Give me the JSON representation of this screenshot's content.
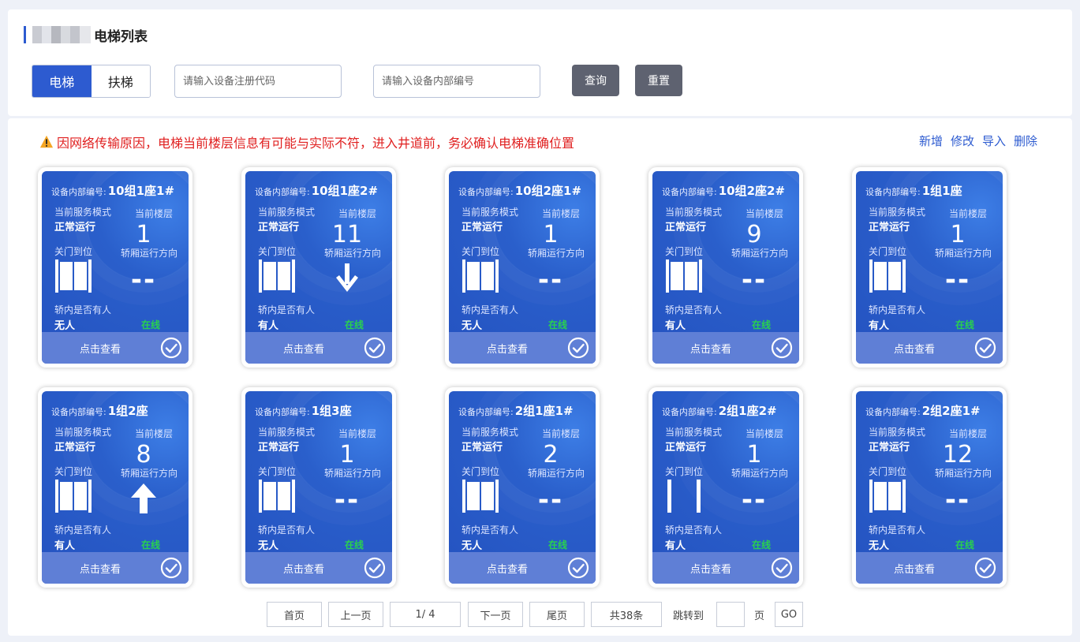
{
  "header": {
    "title": "电梯列表",
    "tabs": [
      {
        "label": "电梯",
        "active": true
      },
      {
        "label": "扶梯",
        "active": false
      }
    ],
    "reg_code_placeholder": "请输入设备注册代码",
    "internal_no_placeholder": "请输入设备内部编号",
    "query_label": "查询",
    "reset_label": "重置"
  },
  "notice": {
    "warning": "因网络传输原因，电梯当前楼层信息有可能与实际不符，进入井道前，务必确认电梯准确位置"
  },
  "actions": {
    "add": "新增",
    "edit": "修改",
    "import": "导入",
    "delete": "删除"
  },
  "labels": {
    "id_key": "设备内部编号:",
    "service_mode": "当前服务模式",
    "current_floor": "当前楼层",
    "door_status": "关门到位",
    "direction": "轿厢运行方向",
    "occupied": "轿内是否有人",
    "view": "点击查看"
  },
  "elevators": [
    {
      "id": "10组1座1#",
      "mode": "正常运行",
      "floor": "1",
      "direction": "none",
      "door": "closed",
      "occupied": "无人",
      "status": "在线"
    },
    {
      "id": "10组1座2#",
      "mode": "正常运行",
      "floor": "11",
      "direction": "down",
      "door": "closed",
      "occupied": "有人",
      "status": "在线"
    },
    {
      "id": "10组2座1#",
      "mode": "正常运行",
      "floor": "1",
      "direction": "none",
      "door": "closed",
      "occupied": "无人",
      "status": "在线"
    },
    {
      "id": "10组2座2#",
      "mode": "正常运行",
      "floor": "9",
      "direction": "none",
      "door": "closed",
      "occupied": "有人",
      "status": "在线"
    },
    {
      "id": "1组1座",
      "mode": "正常运行",
      "floor": "1",
      "direction": "none",
      "door": "closed",
      "occupied": "有人",
      "status": "在线"
    },
    {
      "id": "1组2座",
      "mode": "正常运行",
      "floor": "8",
      "direction": "up",
      "door": "closed",
      "occupied": "有人",
      "status": "在线"
    },
    {
      "id": "1组3座",
      "mode": "正常运行",
      "floor": "1",
      "direction": "none",
      "door": "closed",
      "occupied": "无人",
      "status": "在线"
    },
    {
      "id": "2组1座1#",
      "mode": "正常运行",
      "floor": "2",
      "direction": "none",
      "door": "closed",
      "occupied": "无人",
      "status": "在线"
    },
    {
      "id": "2组1座2#",
      "mode": "正常运行",
      "floor": "1",
      "direction": "none",
      "door": "open",
      "occupied": "有人",
      "status": "在线"
    },
    {
      "id": "2组2座1#",
      "mode": "正常运行",
      "floor": "12",
      "direction": "none",
      "door": "closed",
      "occupied": "无人",
      "status": "在线"
    }
  ],
  "pagination": {
    "first": "首页",
    "prev": "上一页",
    "page": "1/ 4",
    "next": "下一页",
    "last": "尾页",
    "total": "共38条",
    "jump": "跳转到",
    "page_unit": "页",
    "go": "GO"
  },
  "colors": {
    "primary": "#2d5bd0",
    "warning": "#e02020",
    "online": "#29d14e",
    "card_footer": "#5f7fd6"
  }
}
